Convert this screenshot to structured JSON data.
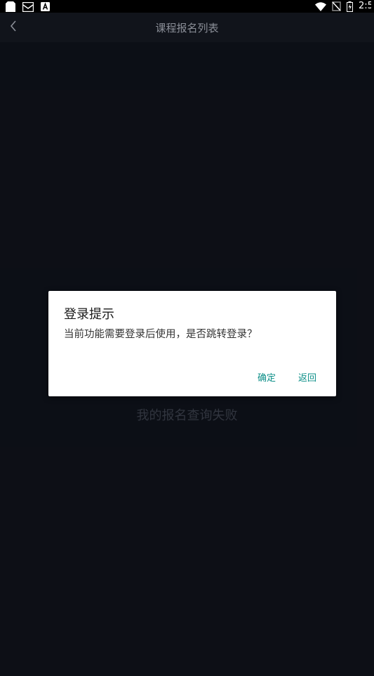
{
  "status_bar": {
    "time": "2:5",
    "icons": [
      "sd-card-icon",
      "mail-icon",
      "a-badge-icon",
      "wifi-icon",
      "no-sim-icon",
      "battery-icon"
    ]
  },
  "header": {
    "title": "课程报名列表",
    "back_icon": "chevron-left-icon"
  },
  "main": {
    "empty_message": "我的报名查询失败"
  },
  "dialog": {
    "title": "登录提示",
    "message": "当前功能需要登录后使用，是否跳转登录？",
    "confirm_label": "确定",
    "cancel_label": "返回"
  },
  "colors": {
    "background": "#0f121a",
    "accent": "#0d8f88",
    "dialog_bg": "#ffffff"
  }
}
